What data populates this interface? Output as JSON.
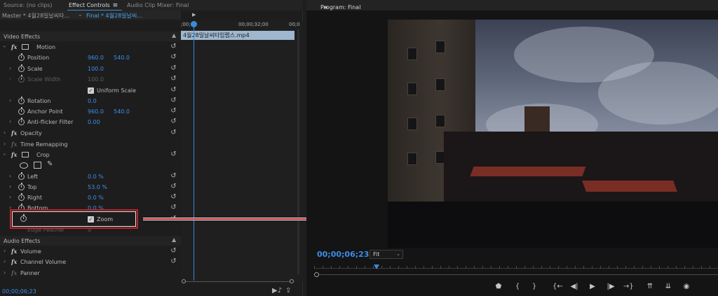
{
  "tabs": {
    "source": "Source: (no clips)",
    "effect_controls": "Effect Controls",
    "audio_mixer": "Audio Clip Mixer: Final",
    "menu_glyph": "≡",
    "program": "Program: Final",
    "program_menu": "≡"
  },
  "header": {
    "master": "Master * 4월28일날씨타...",
    "final": "Final * 4월28일날씨..."
  },
  "timeline": {
    "ruler_start": ";00;00",
    "ruler_mid": "00;00;32;00",
    "ruler_end": "00;0",
    "clip_name": "4월28일날씨타임랩스.mp4"
  },
  "video_effects": {
    "section_label": "Video Effects",
    "motion": {
      "label": "Motion",
      "position_label": "Position",
      "position_x": "960.0",
      "position_y": "540.0",
      "scale_label": "Scale",
      "scale_value": "100.0",
      "scale_width_label": "Scale Width",
      "scale_width_value": "100.0",
      "uniform_scale_label": "Uniform Scale",
      "rotation_label": "Rotation",
      "rotation_value": "0.0",
      "anchor_label": "Anchor Point",
      "anchor_x": "960.0",
      "anchor_y": "540.0",
      "antiflicker_label": "Anti-flicker Filter",
      "antiflicker_value": "0.00"
    },
    "opacity_label": "Opacity",
    "time_remap_label": "Time Remapping",
    "crop": {
      "label": "Crop",
      "left_label": "Left",
      "left_value": "0.0 %",
      "top_label": "Top",
      "top_value": "53.0 %",
      "right_label": "Right",
      "right_value": "0.0 %",
      "bottom_label": "Bottom",
      "bottom_value": "0.0 %",
      "zoom_label": "Zoom",
      "edge_feather_label": "Edge Feather",
      "edge_feather_value": "0"
    }
  },
  "audio_effects": {
    "section_label": "Audio Effects",
    "volume_label": "Volume",
    "channel_volume_label": "Channel Volume",
    "panner_label": "Panner"
  },
  "footer": {
    "timecode": "00;00;06;23"
  },
  "program": {
    "timecode": "00;00;06;23",
    "fit_label": "Fit"
  },
  "icons": {
    "checkmark": "✓",
    "reset": "↺",
    "chevron": "›",
    "chevron_down": "⌄",
    "up": "▲",
    "pen": "✎"
  }
}
